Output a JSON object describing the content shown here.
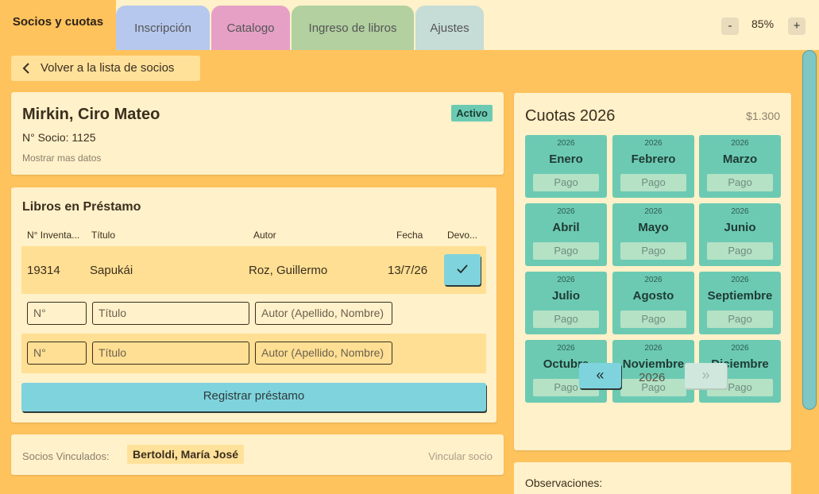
{
  "tabs": [
    {
      "label": "Socios y cuotas",
      "color": "#ffc35d",
      "active": true
    },
    {
      "label": "Inscripción",
      "color": "#b6c8ee"
    },
    {
      "label": "Catalogo",
      "color": "#e6a0c6"
    },
    {
      "label": "Ingreso de libros",
      "color": "#b2d0a0"
    },
    {
      "label": "Ajustes",
      "color": "#c6dcd6"
    }
  ],
  "zoom": {
    "minus": "-",
    "value": "85%",
    "plus": "+"
  },
  "back_button": {
    "label": "Volver a la lista de socios"
  },
  "member": {
    "name": "Mirkin, Ciro Mateo",
    "number": "N° Socio: 1125",
    "more": "Mostrar mas datos",
    "status": "Activo"
  },
  "loans": {
    "title": "Libros en Préstamo",
    "headers": [
      "N° Inventa...",
      "Título",
      "Autor",
      "Fecha",
      "Devo..."
    ],
    "rows": [
      {
        "inventory": "19314",
        "title": "Sapukái",
        "author": "Roz, Guillermo",
        "date": "13/7/26"
      }
    ],
    "placeholders": {
      "number": "N°",
      "title": "Título",
      "author": "Autor (Apellido, Nombre)"
    },
    "register_label": "Registrar préstamo"
  },
  "linked": {
    "label": "Socios Vinculados:",
    "member": "Bertoldi, María José",
    "action": "Vincular socio"
  },
  "fees": {
    "title": "Cuotas 2026",
    "amount": "$1.300",
    "months": [
      {
        "year": "2026",
        "name": "Enero",
        "status": "Pago"
      },
      {
        "year": "2026",
        "name": "Febrero",
        "status": "Pago"
      },
      {
        "year": "2026",
        "name": "Marzo",
        "status": "Pago"
      },
      {
        "year": "2026",
        "name": "Abril",
        "status": "Pago"
      },
      {
        "year": "2026",
        "name": "Mayo",
        "status": "Pago"
      },
      {
        "year": "2026",
        "name": "Junio",
        "status": "Pago"
      },
      {
        "year": "2026",
        "name": "Julio",
        "status": "Pago"
      },
      {
        "year": "2026",
        "name": "Agosto",
        "status": "Pago"
      },
      {
        "year": "2026",
        "name": "Septiembre",
        "status": "Pago"
      },
      {
        "year": "2026",
        "name": "Octubre",
        "status": "Pago"
      },
      {
        "year": "2026",
        "name": "Noviembre",
        "status": "Pago"
      },
      {
        "year": "2026",
        "name": "Diciembre",
        "status": "Pago"
      }
    ],
    "prev_icon": "«",
    "next_icon": "»",
    "year": "2026"
  },
  "observations": {
    "label": "Observaciones:"
  },
  "icons": {
    "back": "chevron-left-icon",
    "check": "check-icon",
    "prev": "double-chevron-left-icon",
    "next": "double-chevron-right-icon"
  }
}
